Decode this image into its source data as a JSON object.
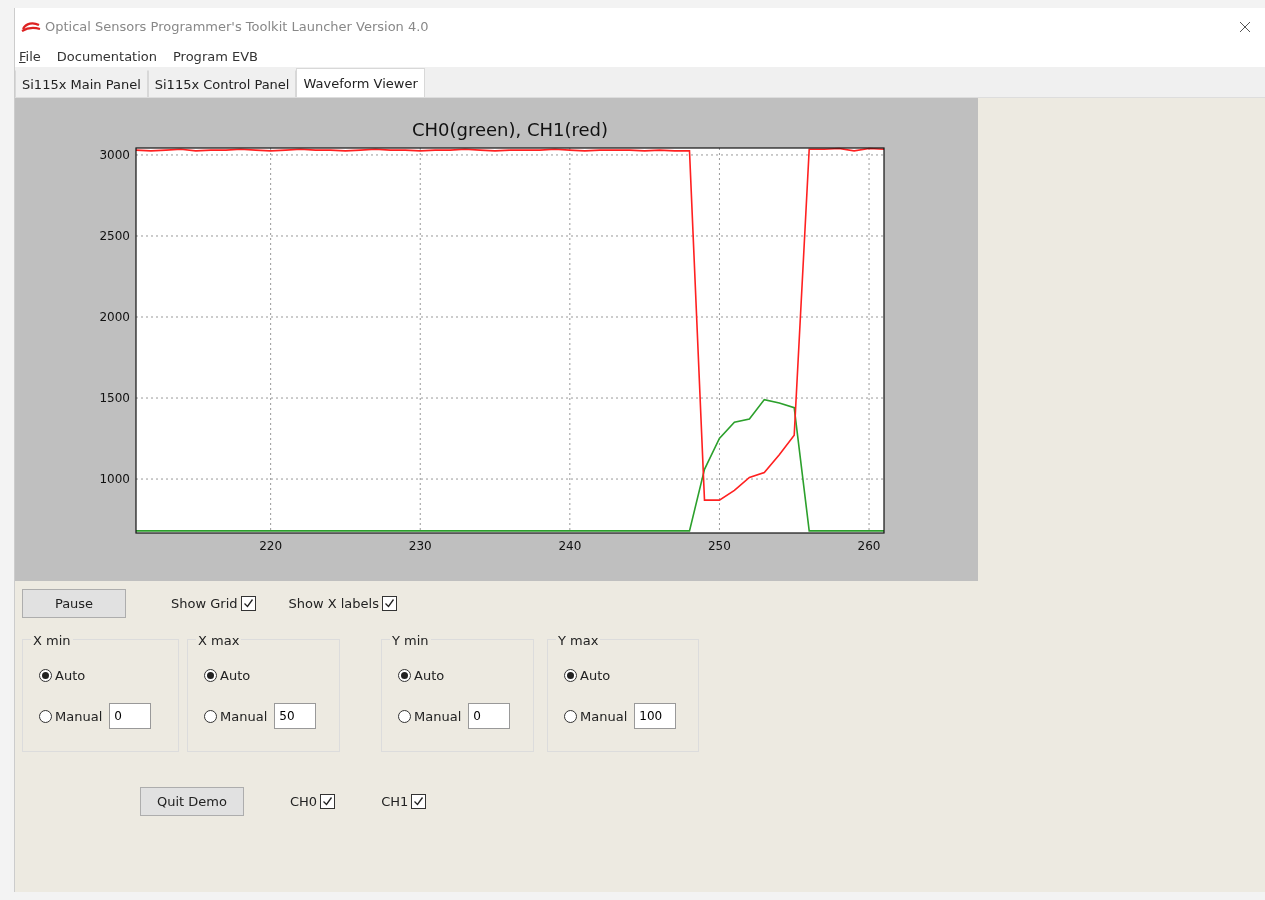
{
  "window": {
    "title": "Optical Sensors Programmer's Toolkit Launcher Version 4.0"
  },
  "menu": [
    {
      "label": "File",
      "mnemonic": true
    },
    {
      "label": "Documentation"
    },
    {
      "label": "Program EVB"
    }
  ],
  "tabs": [
    {
      "label": "Si115x Main Panel",
      "selected": false
    },
    {
      "label": "Si115x Control Panel",
      "selected": false
    },
    {
      "label": "Waveform Viewer",
      "selected": true
    }
  ],
  "viewer": {
    "chart_data": {
      "type": "line",
      "title": "CH0(green), CH1(red)",
      "x": [
        211,
        212,
        213,
        214,
        215,
        216,
        217,
        218,
        219,
        220,
        221,
        222,
        223,
        224,
        225,
        226,
        227,
        228,
        229,
        230,
        231,
        232,
        233,
        234,
        235,
        236,
        237,
        238,
        239,
        240,
        241,
        242,
        243,
        244,
        245,
        246,
        247,
        248,
        249,
        250,
        251,
        252,
        253,
        254,
        255,
        256,
        257,
        258,
        259,
        260,
        261
      ],
      "xlim": [
        211,
        261
      ],
      "ylim": [
        667,
        3043
      ],
      "xticks": [
        220,
        230,
        240,
        250,
        260
      ],
      "yticks": [
        1000,
        1500,
        2000,
        2500,
        3000
      ],
      "grid": true,
      "series": [
        {
          "color": "#2ca02c",
          "values": [
            680,
            680,
            680,
            680,
            680,
            680,
            680,
            680,
            680,
            680,
            680,
            680,
            680,
            680,
            680,
            680,
            680,
            680,
            680,
            680,
            680,
            680,
            680,
            680,
            680,
            680,
            680,
            680,
            680,
            680,
            680,
            680,
            680,
            680,
            680,
            680,
            680,
            680,
            1060,
            1250,
            1350,
            1370,
            1490,
            1470,
            1440,
            680,
            680,
            680,
            680,
            680,
            680
          ]
        },
        {
          "color": "#ff2020",
          "values": [
            3030,
            3025,
            3030,
            3035,
            3025,
            3030,
            3030,
            3035,
            3030,
            3025,
            3030,
            3035,
            3030,
            3030,
            3025,
            3030,
            3035,
            3030,
            3030,
            3025,
            3030,
            3030,
            3035,
            3030,
            3025,
            3030,
            3030,
            3030,
            3035,
            3030,
            3025,
            3030,
            3030,
            3030,
            3025,
            3030,
            3025,
            3025,
            870,
            870,
            930,
            1010,
            1040,
            1150,
            1270,
            3035,
            3035,
            3040,
            3025,
            3040,
            3035
          ]
        }
      ]
    }
  },
  "pause_button": "Pause",
  "show_grid": {
    "label": "Show Grid",
    "checked": true
  },
  "show_x_labels": {
    "label": "Show X labels",
    "checked": true
  },
  "groups": [
    {
      "title": "X min",
      "options": [
        {
          "label": "Auto",
          "selected": true
        },
        {
          "label": "Manual",
          "selected": false
        }
      ],
      "value": "0"
    },
    {
      "title": "X max",
      "options": [
        {
          "label": "Auto",
          "selected": true
        },
        {
          "label": "Manual",
          "selected": false
        }
      ],
      "value": "50"
    },
    {
      "title": "Y min",
      "options": [
        {
          "label": "Auto",
          "selected": true
        },
        {
          "label": "Manual",
          "selected": false
        }
      ],
      "value": "0"
    },
    {
      "title": "Y max",
      "options": [
        {
          "label": "Auto",
          "selected": true
        },
        {
          "label": "Manual",
          "selected": false
        }
      ],
      "value": "100"
    }
  ],
  "quit_button": "Quit Demo",
  "channels": [
    {
      "label": "CH0",
      "checked": true
    },
    {
      "label": "CH1",
      "checked": true
    }
  ]
}
